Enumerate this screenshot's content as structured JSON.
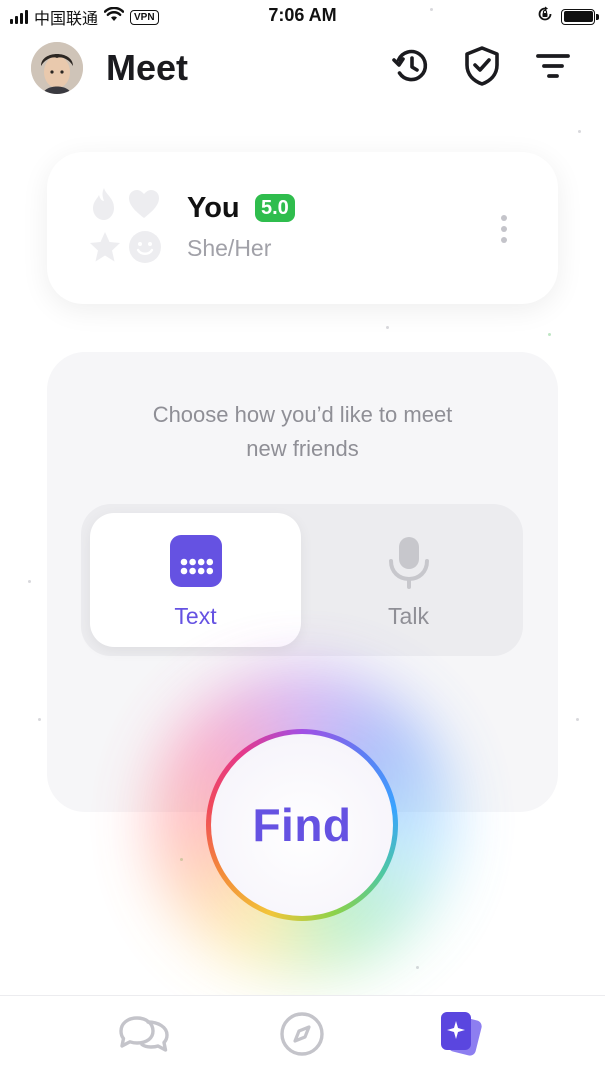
{
  "status_bar": {
    "carrier": "中国联通",
    "vpn": "VPN",
    "time": "7:06 AM"
  },
  "header": {
    "title": "Meet",
    "icons": [
      "history-icon",
      "shield-check-icon",
      "filter-icon"
    ]
  },
  "profile": {
    "name": "You",
    "rating": "5.0",
    "pronouns": "She/Her",
    "badge_icons": [
      "flame-icon",
      "heart-icon",
      "star-icon",
      "smile-icon"
    ]
  },
  "mode_picker": {
    "prompt": "Choose how you’d like to meet new friends",
    "options": [
      {
        "label": "Text",
        "icon": "keyboard-icon",
        "selected": true
      },
      {
        "label": "Talk",
        "icon": "microphone-icon",
        "selected": false
      }
    ]
  },
  "find_button": {
    "label": "Find"
  },
  "bottom_nav": {
    "items": [
      {
        "icon": "chat-bubbles-icon",
        "active": false
      },
      {
        "icon": "compass-icon",
        "active": false
      },
      {
        "icon": "cards-sparkle-icon",
        "active": true
      }
    ]
  },
  "colors": {
    "accent": "#6552e2",
    "rating_green": "#2fbd4d",
    "muted_text": "#a1a1a8",
    "panel_bg": "#f6f6f8"
  }
}
